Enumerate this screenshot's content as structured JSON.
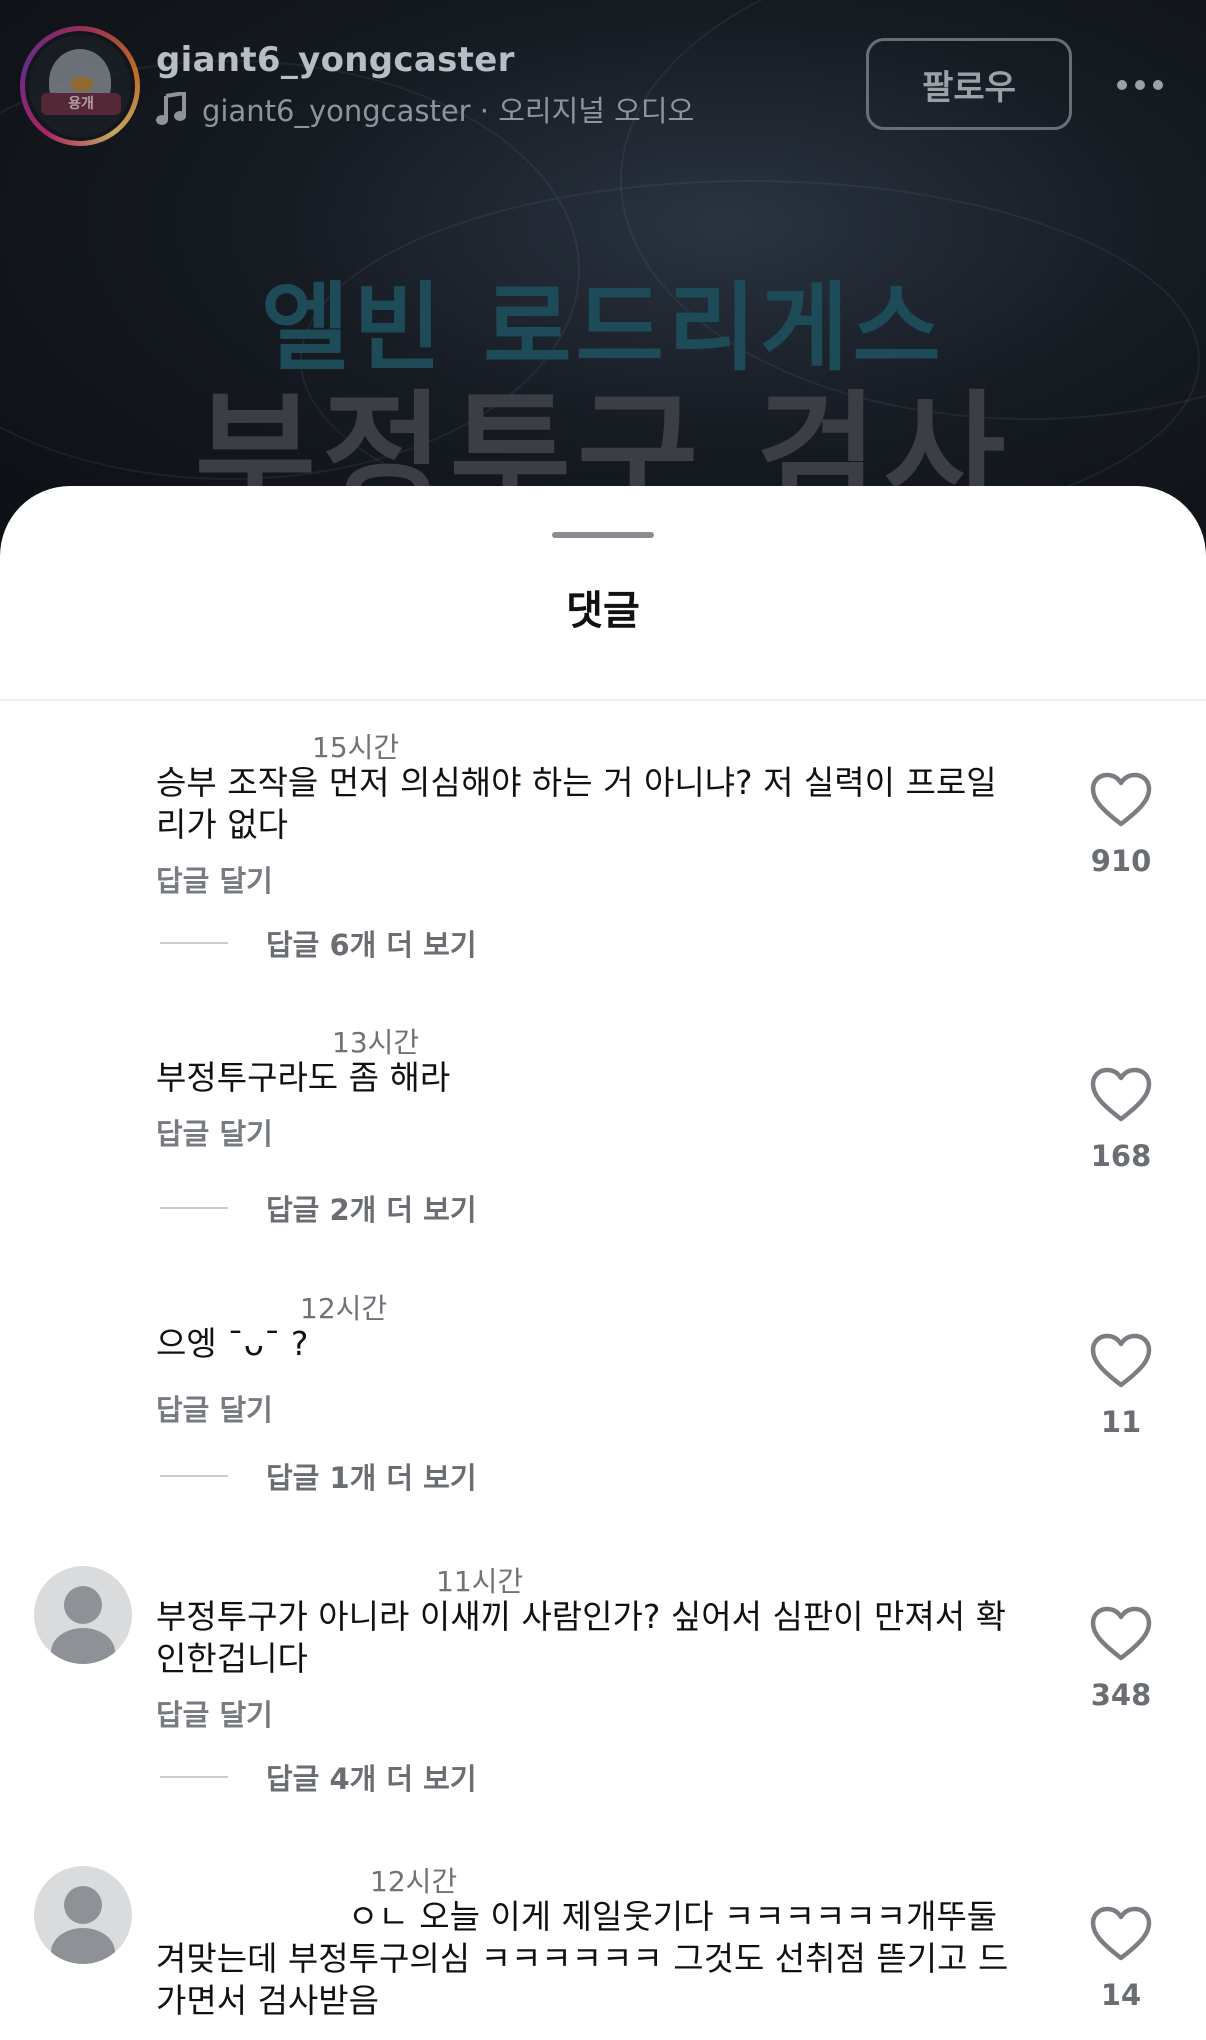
{
  "header": {
    "author": "giant6_yongcaster",
    "audio": "giant6_yongcaster · 오리지널 오디오",
    "follow_label": "팔로우",
    "avatar_tag": "용개",
    "more_icon": "more-icon"
  },
  "video": {
    "title_line1": "엘빈 로드리게스",
    "title_line2": "부정투구 검사"
  },
  "sheet": {
    "title": "댓글"
  },
  "comments": [
    {
      "time": "15시간",
      "text": "승부 조작을 먼저 의심해야 하는 거 아니냐? 저 실력이 프로일 리가 없다",
      "reply_label": "답글 달기",
      "more_replies": "답글 6개 더 보기",
      "likes": "910"
    },
    {
      "time": "13시간",
      "text": "부정투구라도 좀 해라",
      "reply_label": "답글 달기",
      "more_replies": "답글 2개 더 보기",
      "likes": "168"
    },
    {
      "time": "12시간",
      "text": "으엥 ¯ᴗ¯ ?",
      "reply_label": "답글 달기",
      "more_replies": "답글 1개 더 보기",
      "likes": "11"
    },
    {
      "time": "11시간",
      "text": "부정투구가 아니라 이새끼 사람인가? 싶어서 심판이 만져서 확인한겁니다",
      "reply_label": "답글 달기",
      "more_replies": "답글 4개 더 보기",
      "likes": "348"
    },
    {
      "time": "12시간",
      "text_line1": "ㅇㄴ 오늘 이게 제일웃기다 ㅋㅋㅋㅋㅋㅋ개뚜둘",
      "text_rest": "겨맞는데 부정투구의심 ㅋㅋㅋㅋㅋㅋ 그것도 선취점 뜯기고 드가면서 검사받음",
      "likes": "14"
    }
  ],
  "colors": {
    "video_bg": "#12161b",
    "title1": "#1d4b57",
    "title2": "#3b3f45",
    "text_primary": "#111111",
    "text_secondary": "#6f7378"
  }
}
